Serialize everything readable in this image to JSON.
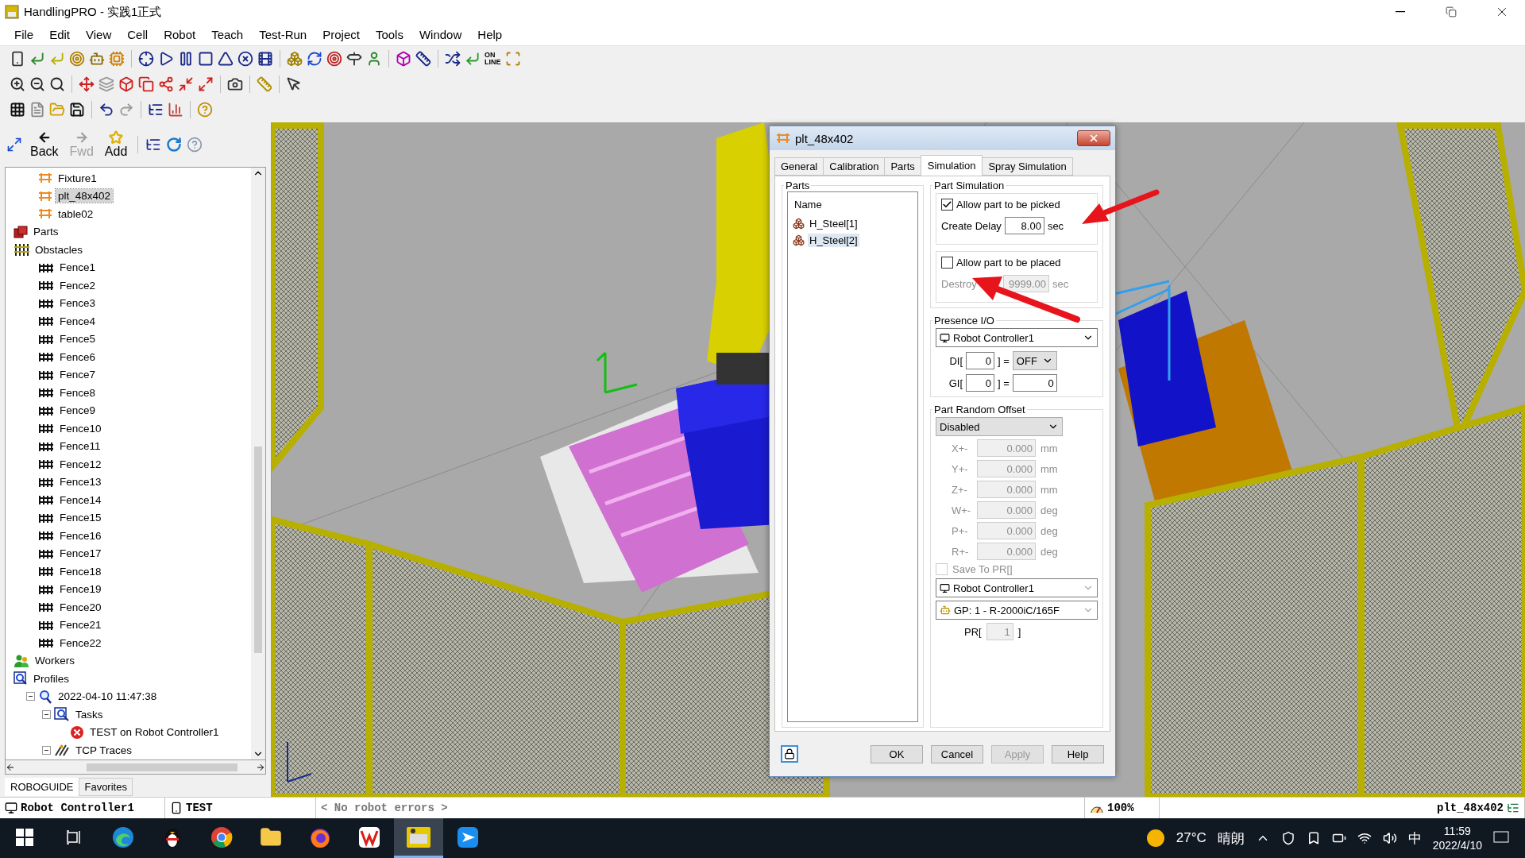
{
  "window": {
    "title": "HandlingPRO - 实践1正式"
  },
  "menu": [
    "File",
    "Edit",
    "View",
    "Cell",
    "Robot",
    "Teach",
    "Test-Run",
    "Project",
    "Tools",
    "Window",
    "Help"
  ],
  "toolbar": {
    "online_label": [
      "ON",
      "LINE"
    ]
  },
  "nav": {
    "buttons": [
      {
        "label": "Back",
        "disabled": false
      },
      {
        "label": "Fwd",
        "disabled": true
      },
      {
        "label": "Add",
        "disabled": false
      }
    ]
  },
  "tree": [
    {
      "children": [
        {
          "label": "Fixture1",
          "kind": "fixture",
          "selected": false
        },
        {
          "label": "plt_48x402",
          "kind": "fixture",
          "selected": true
        },
        {
          "label": "table02",
          "kind": "fixture",
          "selected": false
        }
      ]
    },
    {
      "label": "Parts",
      "kind": "parts",
      "selected": false
    },
    {
      "label": "Obstacles",
      "kind": "obstacles",
      "selected": false,
      "children": [
        {
          "label": "Fence1",
          "kind": "fence",
          "selected": false
        },
        {
          "label": "Fence2",
          "kind": "fence",
          "selected": false
        },
        {
          "label": "Fence3",
          "kind": "fence",
          "selected": false
        },
        {
          "label": "Fence4",
          "kind": "fence",
          "selected": false
        },
        {
          "label": "Fence5",
          "kind": "fence",
          "selected": false
        },
        {
          "label": "Fence6",
          "kind": "fence",
          "selected": false
        },
        {
          "label": "Fence7",
          "kind": "fence",
          "selected": false
        },
        {
          "label": "Fence8",
          "kind": "fence",
          "selected": false
        },
        {
          "label": "Fence9",
          "kind": "fence",
          "selected": false
        },
        {
          "label": "Fence10",
          "kind": "fence",
          "selected": false
        },
        {
          "label": "Fence11",
          "kind": "fence",
          "selected": false
        },
        {
          "label": "Fence12",
          "kind": "fence",
          "selected": false
        },
        {
          "label": "Fence13",
          "kind": "fence",
          "selected": false
        },
        {
          "label": "Fence14",
          "kind": "fence",
          "selected": false
        },
        {
          "label": "Fence15",
          "kind": "fence",
          "selected": false
        },
        {
          "label": "Fence16",
          "kind": "fence",
          "selected": false
        },
        {
          "label": "Fence17",
          "kind": "fence",
          "selected": false
        },
        {
          "label": "Fence18",
          "kind": "fence",
          "selected": false
        },
        {
          "label": "Fence19",
          "kind": "fence",
          "selected": false
        },
        {
          "label": "Fence20",
          "kind": "fence",
          "selected": false
        },
        {
          "label": "Fence21",
          "kind": "fence",
          "selected": false
        },
        {
          "label": "Fence22",
          "kind": "fence",
          "selected": false
        }
      ]
    },
    {
      "label": "Workers",
      "kind": "workers",
      "selected": false
    },
    {
      "label": "Profiles",
      "kind": "profiles",
      "selected": false,
      "children": [
        {
          "label": "2022-04-10 11:47:38",
          "kind": "profile",
          "selected": false,
          "expanded": true,
          "children": [
            {
              "label": "Tasks",
              "kind": "tasks",
              "selected": false,
              "expanded": true,
              "children": [
                {
                  "label": "TEST on Robot Controller1",
                  "kind": "error-task",
                  "selected": false
                }
              ]
            },
            {
              "label": "TCP Traces",
              "kind": "traces",
              "selected": false,
              "expanded": true
            }
          ]
        }
      ]
    }
  ],
  "panel_tabs": [
    {
      "label": "ROBOGUIDE",
      "selected": true
    },
    {
      "label": "Favorites",
      "selected": false
    }
  ],
  "dialog": {
    "title": "plt_48x402",
    "tabs": [
      {
        "label": "General",
        "selected": false
      },
      {
        "label": "Calibration",
        "selected": false
      },
      {
        "label": "Parts",
        "selected": false
      },
      {
        "label": "Simulation",
        "selected": true
      },
      {
        "label": "Spray Simulation",
        "selected": false
      }
    ],
    "parts": {
      "title": "Parts",
      "column": "Name",
      "items": [
        {
          "label": "H_Steel[1]",
          "selected": false
        },
        {
          "label": "H_Steel[2]",
          "selected": true
        }
      ]
    },
    "part_simulation": {
      "title": "Part Simulation",
      "pick": {
        "label": "Allow part to be picked",
        "checked": true
      },
      "create_delay": {
        "label": "Create Delay",
        "value": "8.00",
        "unit": "sec",
        "disabled": false
      },
      "place": {
        "label": "Allow part to be placed",
        "checked": false
      },
      "destroy_delay": {
        "label": "Destroy",
        "value": "9999.00",
        "unit": "sec",
        "disabled": true
      }
    },
    "presence_io": {
      "title": "Presence I/O",
      "controller": "Robot Controller1",
      "rows": [
        {
          "kind": "dropdown",
          "prefix": "DI[",
          "index": "0",
          "equals": "] =",
          "value": "OFF"
        },
        {
          "kind": "field",
          "prefix": "GI[",
          "index": "0",
          "equals": "] =",
          "value": "0"
        }
      ]
    },
    "random_offset": {
      "title": "Part Random Offset",
      "mode": "Disabled",
      "disabled": true,
      "offsets": [
        {
          "label": "X+-",
          "value": "0.000",
          "unit": "mm"
        },
        {
          "label": "Y+-",
          "value": "0.000",
          "unit": "mm"
        },
        {
          "label": "Z+-",
          "value": "0.000",
          "unit": "mm"
        },
        {
          "label": "W+-",
          "value": "0.000",
          "unit": "deg"
        },
        {
          "label": "P+-",
          "value": "0.000",
          "unit": "deg"
        },
        {
          "label": "R+-",
          "value": "0.000",
          "unit": "deg"
        }
      ],
      "save_to_pr": {
        "label": "Save To PR[]",
        "checked": false,
        "disabled": true
      },
      "controller": "Robot Controller1",
      "group": "GP: 1 - R-2000iC/165F",
      "pr": {
        "prefix": "PR[",
        "value": "1",
        "suffix": "]"
      }
    },
    "buttons": [
      {
        "label": "OK",
        "disabled": false
      },
      {
        "label": "Cancel",
        "disabled": false
      },
      {
        "label": "Apply",
        "disabled": true
      },
      {
        "label": "Help",
        "disabled": false
      }
    ]
  },
  "status_bar": {
    "controller": "Robot Controller1",
    "program": "TEST",
    "errors": "< No robot errors >",
    "zoom": "100%",
    "selection": "plt_48x402"
  },
  "taskbar": {
    "apps": [
      {
        "kind": "start",
        "selected": false
      },
      {
        "kind": "task-view",
        "selected": false
      },
      {
        "kind": "wave-browser",
        "selected": false
      },
      {
        "kind": "penguin",
        "selected": false
      },
      {
        "kind": "ring-browser",
        "selected": false
      },
      {
        "kind": "folder",
        "selected": false
      },
      {
        "kind": "fox-browser",
        "selected": false
      },
      {
        "kind": "office",
        "selected": false
      },
      {
        "kind": "robot-app",
        "selected": true
      },
      {
        "kind": "paper-plane",
        "selected": false
      }
    ],
    "weather": "27°C",
    "condition": "晴朗",
    "ime": "中",
    "time": "11:59",
    "date": "2022/4/10"
  }
}
